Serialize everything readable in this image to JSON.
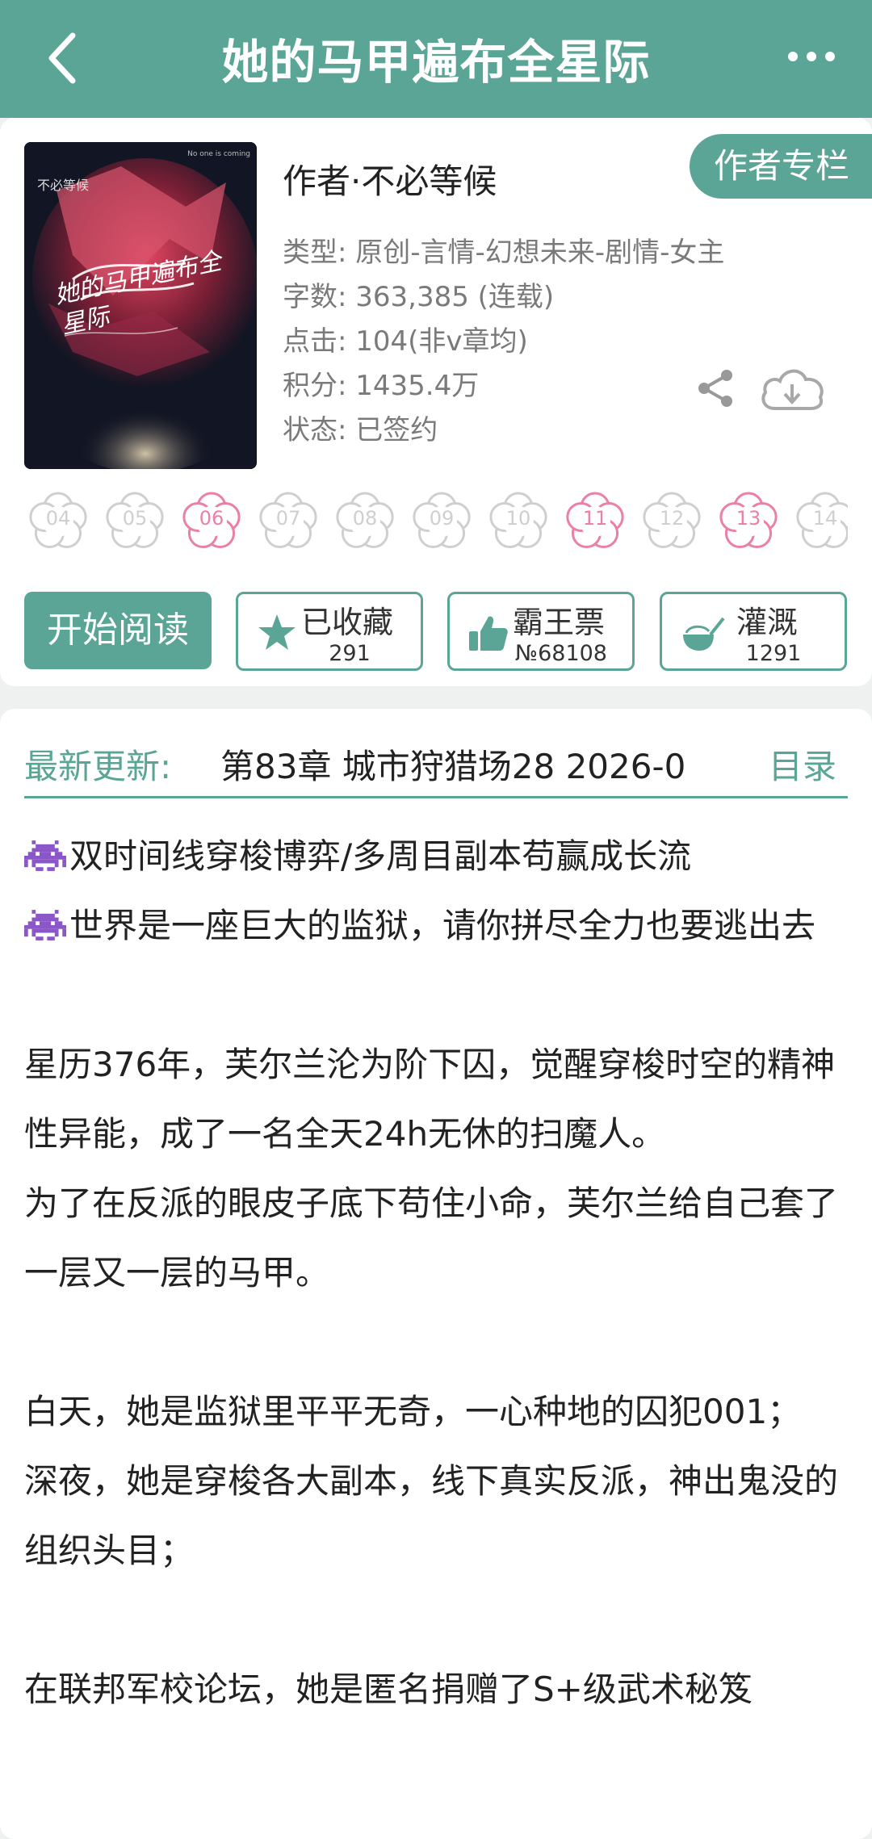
{
  "header": {
    "title": "她的马甲遍布全星际"
  },
  "book": {
    "cover_author": "不必等候",
    "cover_title": "她的马甲遍布全星际",
    "cover_tagline": "No one is coming",
    "author": "作者·不必等候",
    "author_column_label": "作者专栏",
    "meta": [
      "类型: 原创-言情-幻想未来-剧情-女主",
      "字数: 363,385 (连载)",
      "点击: 104(非v章均)",
      "积分: 1435.4万",
      "状态: 已签约"
    ]
  },
  "ratings": {
    "labels": [
      "04",
      "05",
      "06",
      "07",
      "08",
      "09",
      "10",
      "11",
      "12",
      "13",
      "14"
    ],
    "active": [
      "06",
      "11",
      "13"
    ]
  },
  "actions": {
    "read": "开始阅读",
    "collect": {
      "label": "已收藏",
      "count": "291"
    },
    "ticket": {
      "label": "霸王票",
      "count": "№68108"
    },
    "water": {
      "label": "灌溉",
      "count": "1291"
    }
  },
  "latest": {
    "label": "最新更新:",
    "chapter": "第83章  城市狩猎场28  2026-0",
    "toc": "目录"
  },
  "description": [
    {
      "icon": true,
      "text": "双时间线穿梭博弈/多周目副本苟赢成长流"
    },
    {
      "icon": true,
      "text": "世界是一座巨大的监狱，请你拼尽全力也要逃出去"
    },
    {
      "gap": true
    },
    {
      "text": "星历376年，芙尔兰沦为阶下囚，觉醒穿梭时空的精神性异能，成了一名全天24h无休的扫魔人。"
    },
    {
      "text": "为了在反派的眼皮子底下苟住小命，芙尔兰给自己套了一层又一层的马甲。"
    },
    {
      "gap": true
    },
    {
      "text": "白天，她是监狱里平平无奇，一心种地的囚犯001；"
    },
    {
      "text": "深夜，她是穿梭各大副本，线下真实反派，神出鬼没的组织头目；"
    },
    {
      "gap": true
    },
    {
      "text": "在联邦军校论坛，她是匿名捐赠了S+级武术秘笈"
    }
  ],
  "colors": {
    "accent": "#5aa595",
    "flower_active": "#ea7fa7",
    "flower_inactive": "#cfcfcf",
    "invader_icon": "#8a56c8"
  }
}
